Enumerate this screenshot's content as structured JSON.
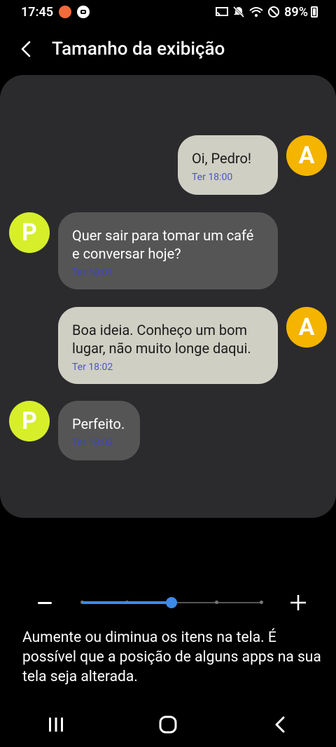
{
  "status_bar": {
    "time": "17:45",
    "battery": "89%",
    "icons": [
      "screen-mirror-icon",
      "mute-icon",
      "wifi-icon",
      "do-not-disturb-icon",
      "battery-icon"
    ]
  },
  "header": {
    "title": "Tamanho da exibição"
  },
  "preview": {
    "messages": [
      {
        "sender": "A",
        "direction": "outgoing",
        "text": "Oi, Pedro!",
        "time": "Ter 18:00"
      },
      {
        "sender": "P",
        "direction": "incoming",
        "text": "Quer sair para tomar um café e conversar hoje?",
        "time": "Ter 18:01"
      },
      {
        "sender": "A",
        "direction": "outgoing",
        "text": "Boa ideia. Conheço um bom lugar, não muito longe daqui.",
        "time": "Ter 18:02"
      },
      {
        "sender": "P",
        "direction": "incoming",
        "text": "Perfeito.",
        "time": "Ter 18:03"
      }
    ]
  },
  "slider": {
    "steps": 5,
    "current_step": 2,
    "value_fraction": 0.5,
    "accent_color": "#3c8be8"
  },
  "description": "Aumente ou diminua os itens na tela. É possível que a posição de alguns apps na sua tela seja alterada.",
  "colors": {
    "avatar_a": "#f4b400",
    "avatar_p": "#d6ef2a",
    "bubble_out": "#cfcfc4",
    "bubble_in": "#555555"
  }
}
